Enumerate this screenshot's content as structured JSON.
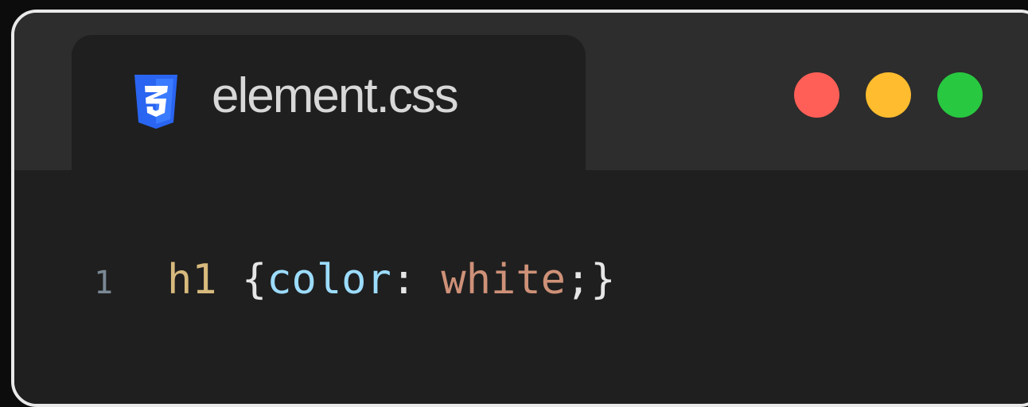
{
  "tab": {
    "filename": "element.css",
    "icon": "css3-icon"
  },
  "window_controls": {
    "close_color": "#ff5f57",
    "minimize_color": "#febc2e",
    "maximize_color": "#28c840"
  },
  "code": {
    "line_number": "1",
    "selector": "h1",
    "open_brace": "{",
    "property": "color",
    "colon": ": ",
    "value": "white",
    "semicolon_close": ";}"
  },
  "syntax_colors": {
    "selector": "#d7ba7d",
    "brace": "#e6e6e6",
    "property": "#9cdcfe",
    "value": "#ce9178"
  }
}
